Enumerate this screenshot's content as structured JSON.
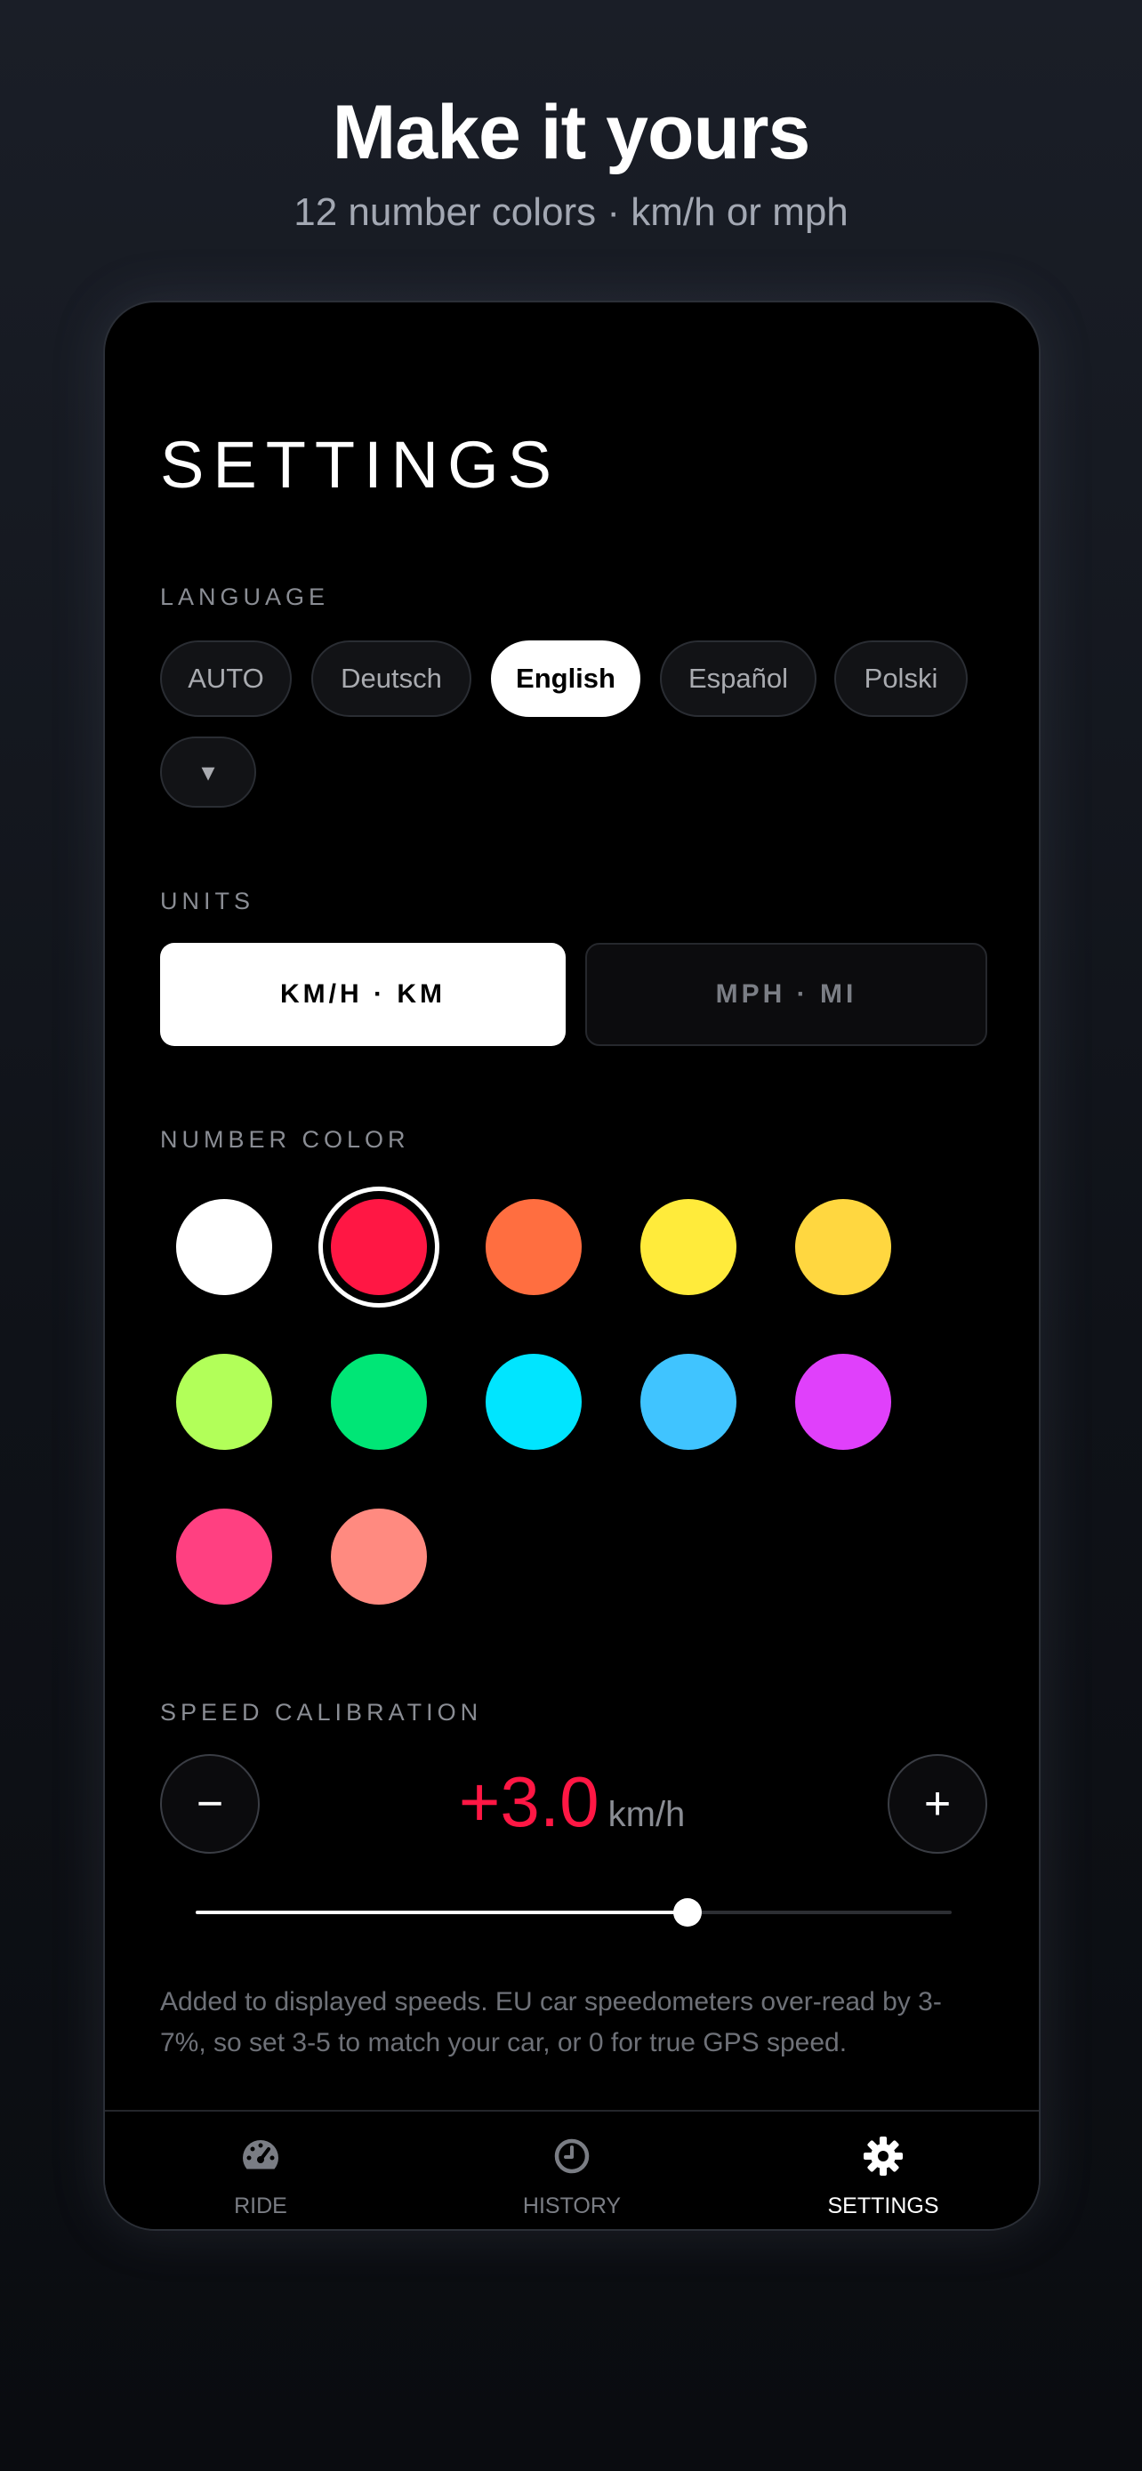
{
  "promo": {
    "title": "Make it yours",
    "subtitle": "12 number colors · km/h or mph"
  },
  "screen": {
    "title": "SETTINGS"
  },
  "language": {
    "label": "LANGUAGE",
    "options": [
      "AUTO",
      "Deutsch",
      "English",
      "Español",
      "Polski"
    ],
    "selected": "English",
    "more_glyph": "▾"
  },
  "units": {
    "label": "UNITS",
    "options": [
      "KM/H · KM",
      "MPH · MI"
    ],
    "selected": "KM/H · KM"
  },
  "number_color": {
    "label": "NUMBER COLOR",
    "selected_index": 1,
    "colors": [
      "#ffffff",
      "#ff1744",
      "#ff6e40",
      "#ffeb3b",
      "#ffd740",
      "#b2ff59",
      "#00e676",
      "#00e5ff",
      "#40c4ff",
      "#e040fb",
      "#ff4081",
      "#ff8a80"
    ]
  },
  "speed_calibration": {
    "label": "SPEED CALIBRATION",
    "value": "+3.0",
    "unit": "km/h",
    "minus": "−",
    "plus": "+",
    "slider_fraction": 0.65,
    "note": "Added to displayed speeds. EU car speedometers over-read by 3-7%, so set 3-5 to match your car, or 0 for true GPS speed."
  },
  "tabs": [
    {
      "label": "RIDE",
      "icon": "speedometer-icon"
    },
    {
      "label": "HISTORY",
      "icon": "clock-icon"
    },
    {
      "label": "SETTINGS",
      "icon": "gear-icon"
    }
  ],
  "active_tab": 2,
  "colors": {
    "accent": "#ff1744",
    "inactive": "#7a7d84"
  }
}
